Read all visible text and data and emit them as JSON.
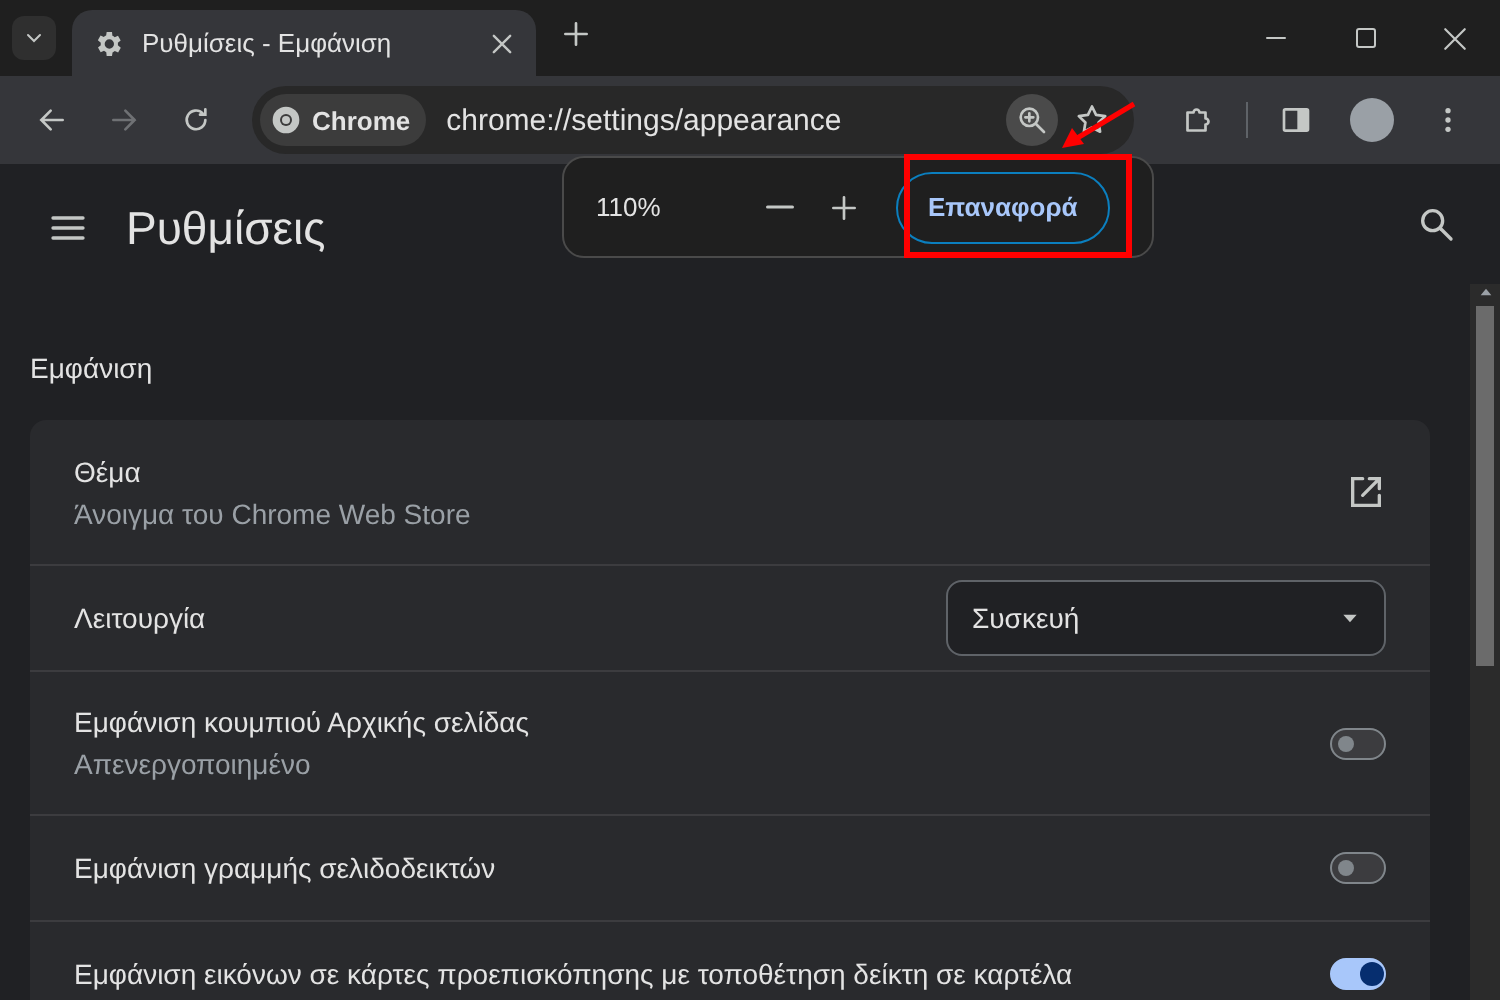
{
  "tab_strip": {
    "tabs": [
      {
        "title": "Ρυθμίσεις - Εμφάνιση",
        "selected": true
      }
    ]
  },
  "toolbar": {
    "chip": "Chrome",
    "url": "chrome://settings/appearance"
  },
  "zoom_popup": {
    "level": "110%",
    "reset_button": "Επαναφορά"
  },
  "header": {
    "title": "Ρυθμίσεις"
  },
  "section": {
    "title": "Εμφάνιση",
    "rows": [
      {
        "kind": "link",
        "label": "Θέμα",
        "sublabel": "Άνοιγμα του Chrome Web Store"
      },
      {
        "kind": "select",
        "label": "Λειτουργία",
        "value": "Συσκευή"
      },
      {
        "kind": "toggle",
        "label": "Εμφάνιση κουμπιού Αρχικής σελίδας",
        "sublabel": "Απενεργοποιημένο",
        "on": false
      },
      {
        "kind": "toggle",
        "label": "Εμφάνιση γραμμής σελιδοδεικτών",
        "on": false
      },
      {
        "kind": "toggle",
        "label": "Εμφάνιση εικόνων σε κάρτες προεπισκόπησης με τοποθέτηση δείκτη σε καρτέλα",
        "on": true
      }
    ]
  }
}
